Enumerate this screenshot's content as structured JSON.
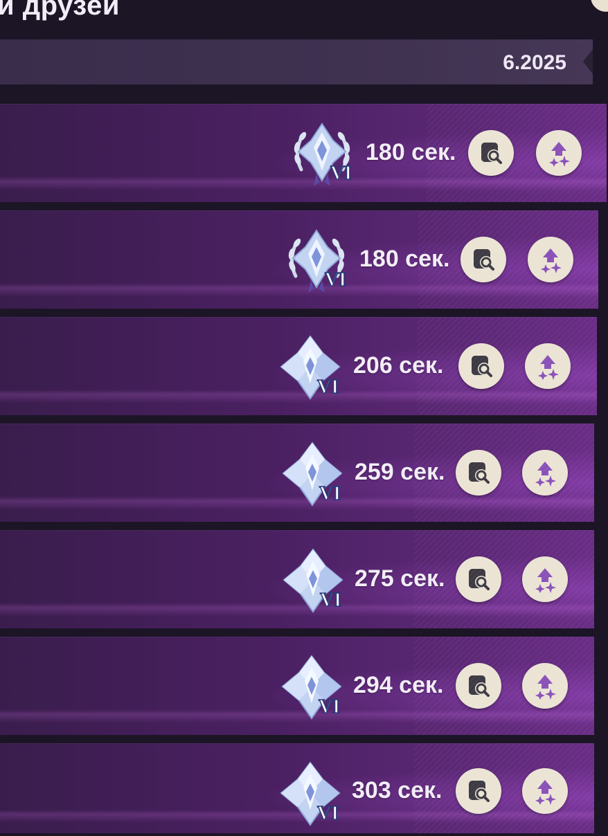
{
  "header": {
    "title": "и друзей",
    "period": "6.2025"
  },
  "rows": [
    {
      "time": "180 сек.",
      "rank_numeral": "VI",
      "emblem": "laurel-crystal-emblem"
    },
    {
      "time": "180 сек.",
      "rank_numeral": "VI",
      "emblem": "laurel-crystal-emblem"
    },
    {
      "time": "206 сек.",
      "rank_numeral": "VI",
      "emblem": "crystal-emblem"
    },
    {
      "time": "259 сек.",
      "rank_numeral": "VI",
      "emblem": "crystal-emblem"
    },
    {
      "time": "275 сек.",
      "rank_numeral": "VI",
      "emblem": "crystal-emblem"
    },
    {
      "time": "294 сек.",
      "rank_numeral": "VI",
      "emblem": "crystal-emblem"
    },
    {
      "time": "303 сек.",
      "rank_numeral": "VI",
      "emblem": "crystal-emblem"
    }
  ],
  "icons": {
    "view": "magnify-page-icon",
    "boost": "sparkle-arrow-icon"
  },
  "colors": {
    "background": "#1c1526",
    "row_purple": "#5c2876",
    "button_cream": "#ebe4d5",
    "view_icon": "#3d3a44",
    "boost_icon": "#8a52b8",
    "text": "#f3edf7"
  }
}
